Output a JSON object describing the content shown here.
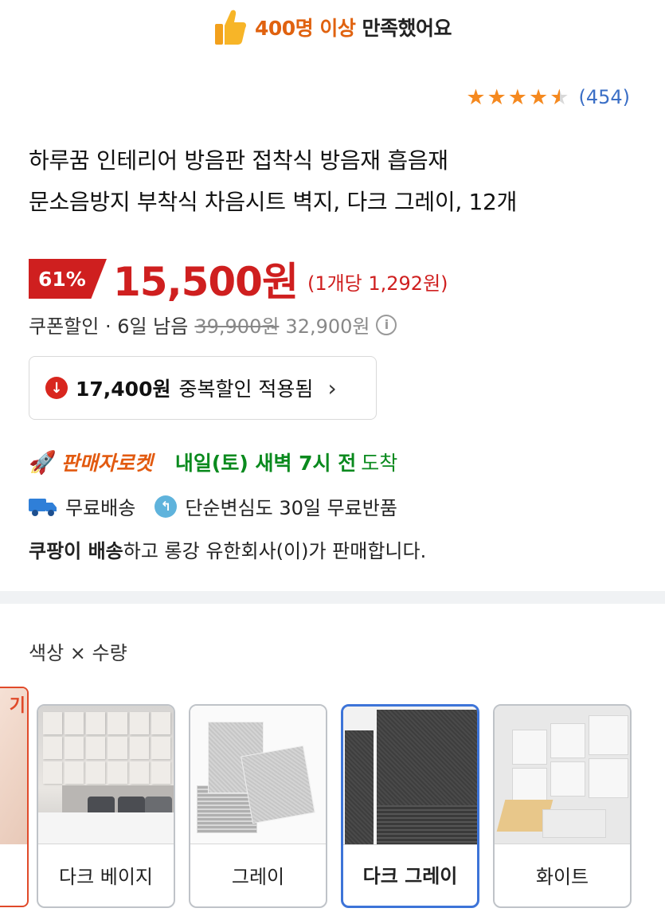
{
  "banner": {
    "icon": "thumbs-up-icon",
    "count_text": "400명 이상",
    "suffix_text": "만족했어요"
  },
  "rating": {
    "stars": 4.5,
    "review_count": "(454)",
    "star_color": "#f5891f"
  },
  "product": {
    "title_line1": "하루꿈 인테리어 방음판 접착식 방음재 흡음재",
    "title_line2": "문소음방지 부착식 차음시트 벽지, 다크 그레이, 12개"
  },
  "price": {
    "discount": "61%",
    "sale_price": "15,500원",
    "unit_price": "(1개당 1,292원)",
    "accent_color": "#cf1f1f"
  },
  "coupon": {
    "label": "쿠폰할인 · 6일 남음",
    "original_price": "39,900원",
    "coupon_price": "32,900원"
  },
  "duplicate_discount": {
    "amount": "17,400원",
    "text": "중복할인 적용됨"
  },
  "delivery": {
    "seller_rocket": "판매자로켓",
    "arrival": "내일(토) 새벽 7시 전",
    "arrival_suffix": "도착",
    "free_shipping": "무료배송",
    "free_return": "단순변심도 30일 무료반품",
    "seller_bold": "쿠팡이 배송",
    "seller_rest": "하고 롱강 유한회사(이)가 판매합니다."
  },
  "options": {
    "title": "색상 × 수량",
    "partial_tag": "기",
    "items": [
      {
        "label": "다크 베이지",
        "selected": false
      },
      {
        "label": "그레이",
        "selected": false
      },
      {
        "label": "다크 그레이",
        "selected": true
      },
      {
        "label": "화이트",
        "selected": false
      }
    ]
  }
}
